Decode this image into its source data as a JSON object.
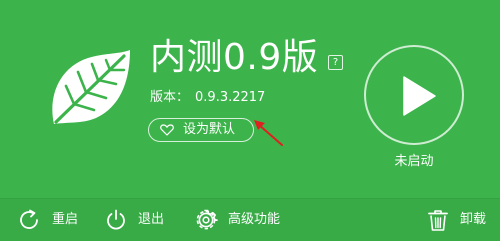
{
  "app": {
    "title": "内测0.9版",
    "help_glyph": "?",
    "version_label": "版本：",
    "version_value": "0.9.3.2217",
    "set_default_label": "设为默认",
    "status_text": "未启动"
  },
  "toolbar": {
    "restart_label": "重启",
    "exit_label": "退出",
    "advanced_label": "高级功能",
    "uninstall_label": "卸载"
  },
  "colors": {
    "background": "#3cb44b",
    "toolbar": "#38ab47",
    "foreground": "#ffffff",
    "annotation_arrow": "#e02020"
  },
  "icons": {
    "logo": "leaf-logo-icon",
    "help": "help-icon",
    "default": "heart-icon",
    "play": "play-icon",
    "restart": "restart-icon",
    "exit": "power-icon",
    "advanced": "gear-icon",
    "uninstall": "trash-icon"
  }
}
